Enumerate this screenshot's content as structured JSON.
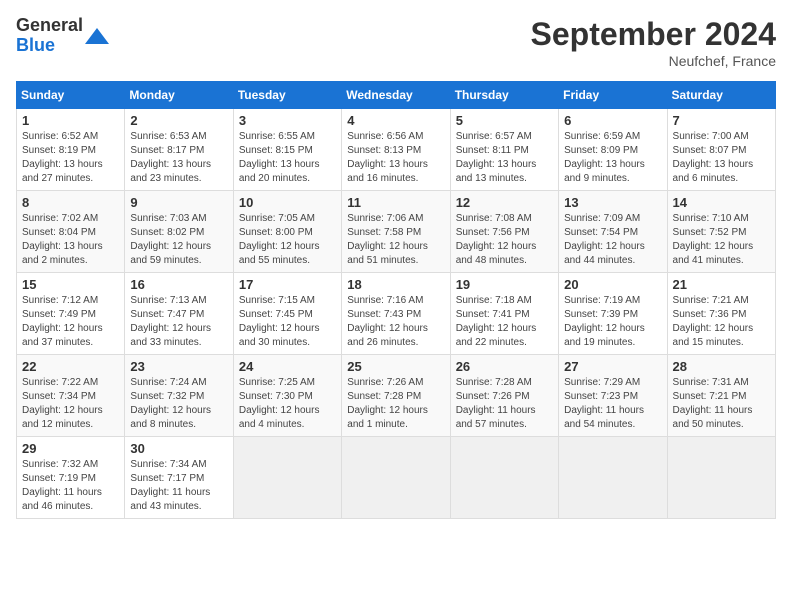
{
  "header": {
    "logo_general": "General",
    "logo_blue": "Blue",
    "month_title": "September 2024",
    "location": "Neufchef, France"
  },
  "days_of_week": [
    "Sunday",
    "Monday",
    "Tuesday",
    "Wednesday",
    "Thursday",
    "Friday",
    "Saturday"
  ],
  "weeks": [
    [
      {
        "day": "1",
        "info": "Sunrise: 6:52 AM\nSunset: 8:19 PM\nDaylight: 13 hours\nand 27 minutes."
      },
      {
        "day": "2",
        "info": "Sunrise: 6:53 AM\nSunset: 8:17 PM\nDaylight: 13 hours\nand 23 minutes."
      },
      {
        "day": "3",
        "info": "Sunrise: 6:55 AM\nSunset: 8:15 PM\nDaylight: 13 hours\nand 20 minutes."
      },
      {
        "day": "4",
        "info": "Sunrise: 6:56 AM\nSunset: 8:13 PM\nDaylight: 13 hours\nand 16 minutes."
      },
      {
        "day": "5",
        "info": "Sunrise: 6:57 AM\nSunset: 8:11 PM\nDaylight: 13 hours\nand 13 minutes."
      },
      {
        "day": "6",
        "info": "Sunrise: 6:59 AM\nSunset: 8:09 PM\nDaylight: 13 hours\nand 9 minutes."
      },
      {
        "day": "7",
        "info": "Sunrise: 7:00 AM\nSunset: 8:07 PM\nDaylight: 13 hours\nand 6 minutes."
      }
    ],
    [
      {
        "day": "8",
        "info": "Sunrise: 7:02 AM\nSunset: 8:04 PM\nDaylight: 13 hours\nand 2 minutes."
      },
      {
        "day": "9",
        "info": "Sunrise: 7:03 AM\nSunset: 8:02 PM\nDaylight: 12 hours\nand 59 minutes."
      },
      {
        "day": "10",
        "info": "Sunrise: 7:05 AM\nSunset: 8:00 PM\nDaylight: 12 hours\nand 55 minutes."
      },
      {
        "day": "11",
        "info": "Sunrise: 7:06 AM\nSunset: 7:58 PM\nDaylight: 12 hours\nand 51 minutes."
      },
      {
        "day": "12",
        "info": "Sunrise: 7:08 AM\nSunset: 7:56 PM\nDaylight: 12 hours\nand 48 minutes."
      },
      {
        "day": "13",
        "info": "Sunrise: 7:09 AM\nSunset: 7:54 PM\nDaylight: 12 hours\nand 44 minutes."
      },
      {
        "day": "14",
        "info": "Sunrise: 7:10 AM\nSunset: 7:52 PM\nDaylight: 12 hours\nand 41 minutes."
      }
    ],
    [
      {
        "day": "15",
        "info": "Sunrise: 7:12 AM\nSunset: 7:49 PM\nDaylight: 12 hours\nand 37 minutes."
      },
      {
        "day": "16",
        "info": "Sunrise: 7:13 AM\nSunset: 7:47 PM\nDaylight: 12 hours\nand 33 minutes."
      },
      {
        "day": "17",
        "info": "Sunrise: 7:15 AM\nSunset: 7:45 PM\nDaylight: 12 hours\nand 30 minutes."
      },
      {
        "day": "18",
        "info": "Sunrise: 7:16 AM\nSunset: 7:43 PM\nDaylight: 12 hours\nand 26 minutes."
      },
      {
        "day": "19",
        "info": "Sunrise: 7:18 AM\nSunset: 7:41 PM\nDaylight: 12 hours\nand 22 minutes."
      },
      {
        "day": "20",
        "info": "Sunrise: 7:19 AM\nSunset: 7:39 PM\nDaylight: 12 hours\nand 19 minutes."
      },
      {
        "day": "21",
        "info": "Sunrise: 7:21 AM\nSunset: 7:36 PM\nDaylight: 12 hours\nand 15 minutes."
      }
    ],
    [
      {
        "day": "22",
        "info": "Sunrise: 7:22 AM\nSunset: 7:34 PM\nDaylight: 12 hours\nand 12 minutes."
      },
      {
        "day": "23",
        "info": "Sunrise: 7:24 AM\nSunset: 7:32 PM\nDaylight: 12 hours\nand 8 minutes."
      },
      {
        "day": "24",
        "info": "Sunrise: 7:25 AM\nSunset: 7:30 PM\nDaylight: 12 hours\nand 4 minutes."
      },
      {
        "day": "25",
        "info": "Sunrise: 7:26 AM\nSunset: 7:28 PM\nDaylight: 12 hours\nand 1 minute."
      },
      {
        "day": "26",
        "info": "Sunrise: 7:28 AM\nSunset: 7:26 PM\nDaylight: 11 hours\nand 57 minutes."
      },
      {
        "day": "27",
        "info": "Sunrise: 7:29 AM\nSunset: 7:23 PM\nDaylight: 11 hours\nand 54 minutes."
      },
      {
        "day": "28",
        "info": "Sunrise: 7:31 AM\nSunset: 7:21 PM\nDaylight: 11 hours\nand 50 minutes."
      }
    ],
    [
      {
        "day": "29",
        "info": "Sunrise: 7:32 AM\nSunset: 7:19 PM\nDaylight: 11 hours\nand 46 minutes."
      },
      {
        "day": "30",
        "info": "Sunrise: 7:34 AM\nSunset: 7:17 PM\nDaylight: 11 hours\nand 43 minutes."
      },
      {
        "day": "",
        "info": ""
      },
      {
        "day": "",
        "info": ""
      },
      {
        "day": "",
        "info": ""
      },
      {
        "day": "",
        "info": ""
      },
      {
        "day": "",
        "info": ""
      }
    ]
  ]
}
